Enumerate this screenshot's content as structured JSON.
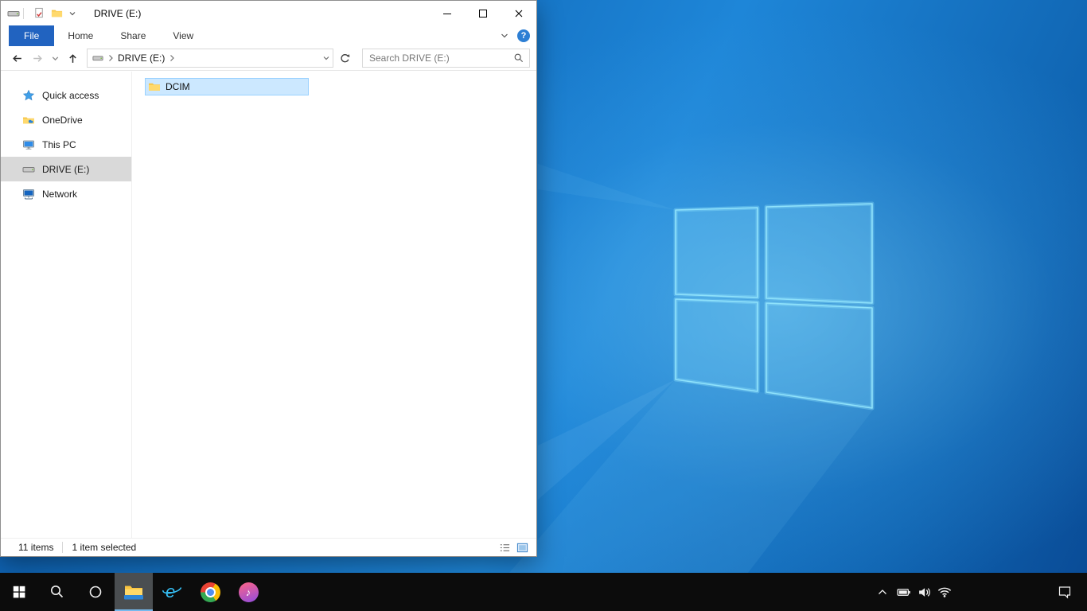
{
  "colors": {
    "accent": "#0078d7",
    "selection_fill": "#cce8ff",
    "selection_border": "#99d1ff",
    "sidebar_selected": "#d9d9d9",
    "taskbar_bg": "#0c0c0c",
    "file_tab_bg": "#2163c0"
  },
  "window": {
    "titlebar": {
      "title": "DRIVE (E:)"
    },
    "ribbon": {
      "file_tab": "File",
      "tabs": [
        "Home",
        "Share",
        "View"
      ]
    },
    "navbar": {
      "breadcrumb": "DRIVE (E:)",
      "search_placeholder": "Search DRIVE (E:)"
    },
    "sidebar": {
      "items": [
        {
          "label": "Quick access",
          "icon": "star-icon"
        },
        {
          "label": "OneDrive",
          "icon": "onedrive-cloud-icon"
        },
        {
          "label": "This PC",
          "icon": "computer-icon"
        },
        {
          "label": "DRIVE (E:)",
          "icon": "drive-icon",
          "selected": true
        },
        {
          "label": "Network",
          "icon": "network-icon"
        }
      ]
    },
    "content": {
      "files": [
        {
          "name": "DCIM",
          "type": "folder",
          "selected": true
        }
      ]
    },
    "statusbar": {
      "items_count": "11 items",
      "selection_count": "1 item selected"
    }
  },
  "glyphs": {
    "help": "?",
    "ie": "e",
    "itunes_note": "♪"
  },
  "taskbar": {
    "buttons": [
      {
        "name": "start",
        "icon": "windows-logo-icon"
      },
      {
        "name": "search",
        "icon": "search-icon"
      },
      {
        "name": "cortana",
        "icon": "cortana-icon"
      },
      {
        "name": "file-explorer",
        "icon": "file-explorer-icon",
        "active": true
      },
      {
        "name": "internet-explorer",
        "icon": "ie-icon"
      },
      {
        "name": "chrome",
        "icon": "chrome-icon"
      },
      {
        "name": "itunes",
        "icon": "itunes-icon"
      }
    ],
    "tray": [
      {
        "icon": "chevron-up-icon"
      },
      {
        "icon": "battery-icon"
      },
      {
        "icon": "speaker-icon"
      },
      {
        "icon": "wifi-icon"
      },
      {
        "icon": "action-center-icon"
      }
    ]
  }
}
